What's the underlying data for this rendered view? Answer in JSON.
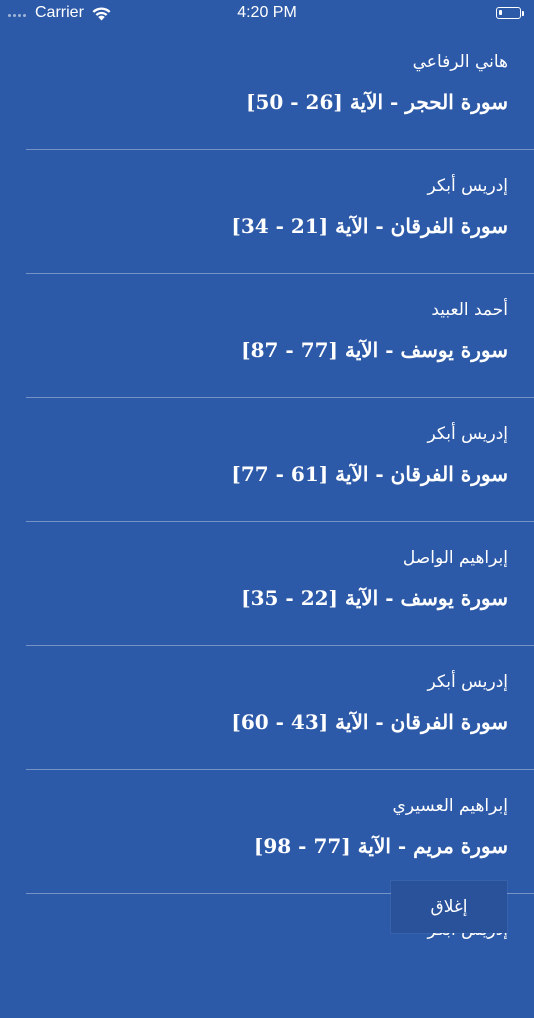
{
  "status_bar": {
    "carrier": "Carrier",
    "time": "4:20 PM",
    "wifi_icon": "wifi-icon",
    "battery_icon": "battery-icon",
    "battery_level": 0.15
  },
  "recitations": [
    {
      "reciter": "هاني الرفاعي",
      "surah": "سورة الحجر - الآية [26 - 50]"
    },
    {
      "reciter": "إدريس أبكر",
      "surah": "سورة الفرقان - الآية [21 - 34]"
    },
    {
      "reciter": "أحمد العبيد",
      "surah": "سورة يوسف - الآية [77 - 87]"
    },
    {
      "reciter": "إدريس أبكر",
      "surah": "سورة الفرقان - الآية [61 - 77]"
    },
    {
      "reciter": "إبراهيم الواصل",
      "surah": "سورة يوسف - الآية [22 - 35]"
    },
    {
      "reciter": "إدريس أبكر",
      "surah": "سورة الفرقان - الآية [43 - 60]"
    },
    {
      "reciter": "إبراهيم العسيري",
      "surah": "سورة مريم - الآية [77 - 98]"
    },
    {
      "reciter": "إدريس أبكر",
      "surah": ""
    }
  ],
  "close_button": {
    "label": "إغلاق"
  }
}
